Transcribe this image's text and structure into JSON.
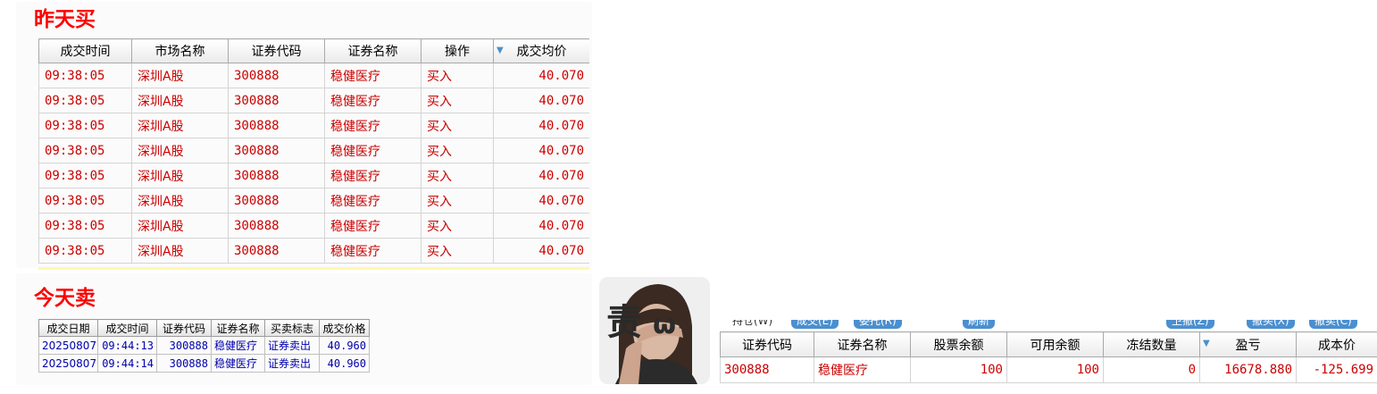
{
  "section_yesterday": {
    "title": "昨天买"
  },
  "section_today": {
    "title": "今天卖"
  },
  "table_buy": {
    "headers": [
      "成交时间",
      "市场名称",
      "证券代码",
      "证券名称",
      "操作",
      "成交均价"
    ],
    "rows": [
      [
        "09:38:05",
        "深圳A股",
        "300888",
        "稳健医疗",
        "买入",
        "40.070"
      ],
      [
        "09:38:05",
        "深圳A股",
        "300888",
        "稳健医疗",
        "买入",
        "40.070"
      ],
      [
        "09:38:05",
        "深圳A股",
        "300888",
        "稳健医疗",
        "买入",
        "40.070"
      ],
      [
        "09:38:05",
        "深圳A股",
        "300888",
        "稳健医疗",
        "买入",
        "40.070"
      ],
      [
        "09:38:05",
        "深圳A股",
        "300888",
        "稳健医疗",
        "买入",
        "40.070"
      ],
      [
        "09:38:05",
        "深圳A股",
        "300888",
        "稳健医疗",
        "买入",
        "40.070"
      ],
      [
        "09:38:05",
        "深圳A股",
        "300888",
        "稳健医疗",
        "买入",
        "40.070"
      ],
      [
        "09:38:05",
        "深圳A股",
        "300888",
        "稳健医疗",
        "买入",
        "40.070"
      ]
    ]
  },
  "table_sell": {
    "headers": [
      "成交日期",
      "成交时间",
      "证券代码",
      "证券名称",
      "买卖标志",
      "成交价格"
    ],
    "rows": [
      [
        "20250807",
        "09:44:13",
        "300888",
        "稳健医疗",
        "证券卖出",
        "40.960"
      ],
      [
        "20250807",
        "09:44:14",
        "300888",
        "稳健医疗",
        "证券卖出",
        "40.960"
      ]
    ]
  },
  "avatar": {
    "overlay_text": "责"
  },
  "position_panel": {
    "tabs": [
      "持仓(W)",
      "成交(E)",
      "委托(R)",
      "刷新",
      "卫撤(Z)",
      "撤买(X)",
      "撤卖(C)"
    ],
    "headers": [
      "证券代码",
      "证券名称",
      "股票余额",
      "可用余额",
      "冻结数量",
      "盈亏",
      "成本价"
    ],
    "rows": [
      [
        "300888",
        "稳健医疗",
        "100",
        "100",
        "0",
        "16678.880",
        "-125.699"
      ]
    ]
  },
  "colors": {
    "accent_red": "#ff0000",
    "cell_red": "#cc0000",
    "cell_blue": "#0000aa",
    "tab_blue": "#4b8fd0"
  }
}
